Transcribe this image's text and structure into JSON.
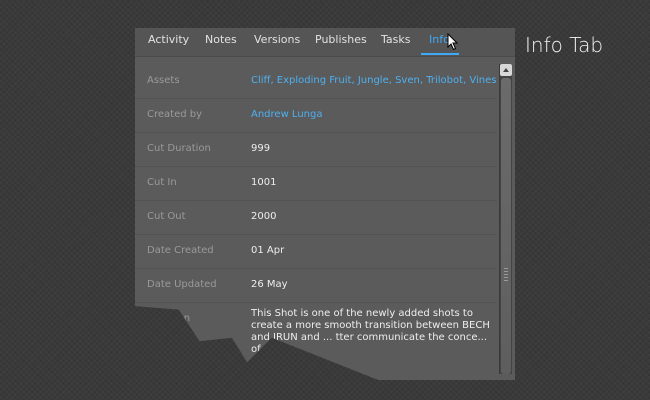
{
  "annotation": "Info Tab",
  "tabs": [
    {
      "label": "Activity"
    },
    {
      "label": "Notes"
    },
    {
      "label": "Versions"
    },
    {
      "label": "Publishes"
    },
    {
      "label": "Tasks"
    },
    {
      "label": "Info",
      "active": true
    }
  ],
  "fields": {
    "assets": {
      "label": "Assets",
      "values": [
        "Cliff",
        "Exploding Fruit",
        "Jungle",
        "Sven",
        "Trilobot",
        "Vines"
      ]
    },
    "created_by": {
      "label": "Created by",
      "value": "Andrew Lunga"
    },
    "cut_duration": {
      "label": "Cut Duration",
      "value": "999"
    },
    "cut_in": {
      "label": "Cut In",
      "value": "1001"
    },
    "cut_out": {
      "label": "Cut Out",
      "value": "2000"
    },
    "date_created": {
      "label": "Date Created",
      "value": "01 Apr"
    },
    "date_updated": {
      "label": "Date Updated",
      "value": "26 May"
    },
    "description": {
      "label": "scription",
      "value": "This Shot is one of the newly added shots to create a more smooth transition between BECH and JRUN and ... tter communicate the conce... of the"
    }
  },
  "colors": {
    "accent": "#3fa9f5",
    "panel": "#5b5b5b",
    "background": "#3a3a3a"
  },
  "icons": {
    "cursor": "mouse-pointer-icon",
    "scroll_up": "scroll-up-arrow-icon"
  }
}
